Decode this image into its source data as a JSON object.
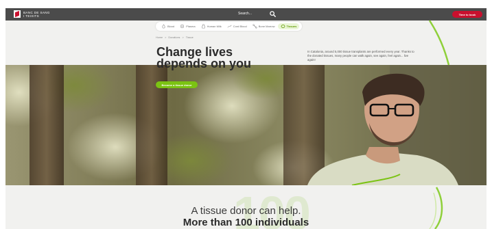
{
  "header": {
    "logo_line1": "BANC DE SANG",
    "logo_line2": "I TEIXITS",
    "search_label": "Search...",
    "cta_label": "Time to book"
  },
  "donation_nav": {
    "items": [
      {
        "label": "Blood",
        "icon": "blood-drop-icon"
      },
      {
        "label": "Plasma",
        "icon": "plasma-icon"
      },
      {
        "label": "Human Milk",
        "icon": "milk-bottle-icon"
      },
      {
        "label": "Cord Blood",
        "icon": "cord-blood-icon"
      },
      {
        "label": "Bone Marrow",
        "icon": "bone-marrow-icon"
      },
      {
        "label": "Tissues",
        "icon": "tissue-icon",
        "active": true
      }
    ]
  },
  "breadcrumb": [
    "Home",
    ">",
    "Donations",
    ">",
    "Tissue"
  ],
  "hero": {
    "title_line1": "Change lives",
    "title_line2": "depends on you",
    "intro": "In Catalonia, around 5,000 tissue transplants are performed every year. Thanks to the donated tissues, many people can walk again, see again, feel again... live again!",
    "cta_label": "Become a tissue donor"
  },
  "stats": {
    "big_number": "100",
    "line1": "A tissue donor can help.",
    "line2": "More than 100 individuals"
  },
  "colors": {
    "brand_red": "#c8102e",
    "accent_green": "#7bc313",
    "header_bg": "#4b4b4b"
  }
}
